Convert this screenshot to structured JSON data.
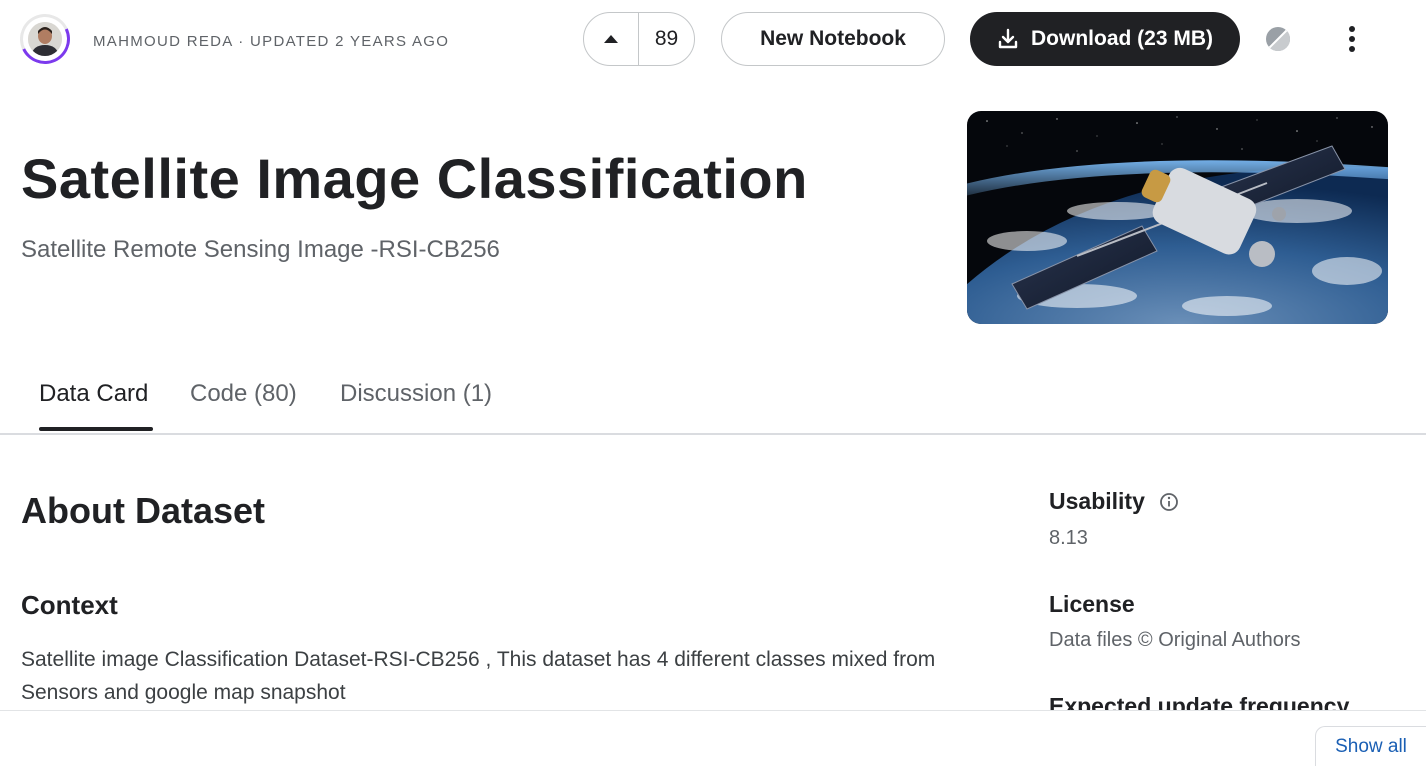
{
  "header": {
    "meta_line": "MAHMOUD REDA · UPDATED 2 YEARS AGO",
    "vote_count": "89",
    "new_notebook_label": "New Notebook",
    "download_label": "Download (23 MB)"
  },
  "dataset": {
    "title": "Satellite Image Classification",
    "subtitle": "Satellite Remote Sensing Image -RSI-CB256"
  },
  "tabs": [
    {
      "label": "Data Card",
      "active": true
    },
    {
      "label": "Code (80)",
      "active": false
    },
    {
      "label": "Discussion (1)",
      "active": false
    }
  ],
  "content": {
    "about_heading": "About Dataset",
    "context_heading": "Context",
    "context_text": "Satellite image Classification Dataset-RSI-CB256 , This dataset has 4 different classes mixed from Sensors and google map snapshot"
  },
  "sidebar": {
    "usability_label": "Usability",
    "usability_value": "8.13",
    "license_label": "License",
    "license_value": "Data files © Original Authors",
    "frequency_label": "Expected update frequency"
  },
  "footer": {
    "show_all_label": "Show all"
  },
  "colors": {
    "primary_dark": "#202124",
    "accent_purple": "#7c3aed",
    "link_blue": "#1a5fb4"
  },
  "icons": {
    "upvote": "triangle-up-icon",
    "download": "download-icon",
    "theme": "theme-toggle-icon",
    "more": "kebab-menu-icon",
    "info": "info-icon"
  }
}
